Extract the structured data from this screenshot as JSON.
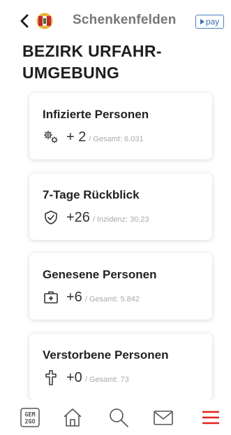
{
  "header": {
    "town": "Schenkenfelden",
    "pay_label": "pay"
  },
  "region_title": "BEZIRK URFAHR-UMGEBUNG",
  "cards": [
    {
      "title": "Infizierte Personen",
      "delta": "+ 2",
      "label": "Gesamt: 6.031",
      "icon": "gears-icon"
    },
    {
      "title": "7-Tage Rückblick",
      "delta": "+26",
      "label": "Inzidenz: 30,23",
      "icon": "shield-check-icon"
    },
    {
      "title": "Genesene Personen",
      "delta": "+6",
      "label": "Gesamt: 5.842",
      "icon": "medical-kit-icon"
    },
    {
      "title": "Verstorbene Personen",
      "delta": "+0",
      "label": "Gesamt: 73",
      "icon": "cross-icon"
    }
  ],
  "bottom_nav": {
    "logo_text_top": "GEM",
    "logo_text_bottom": "2GO",
    "menu_color": "#e2231a"
  }
}
